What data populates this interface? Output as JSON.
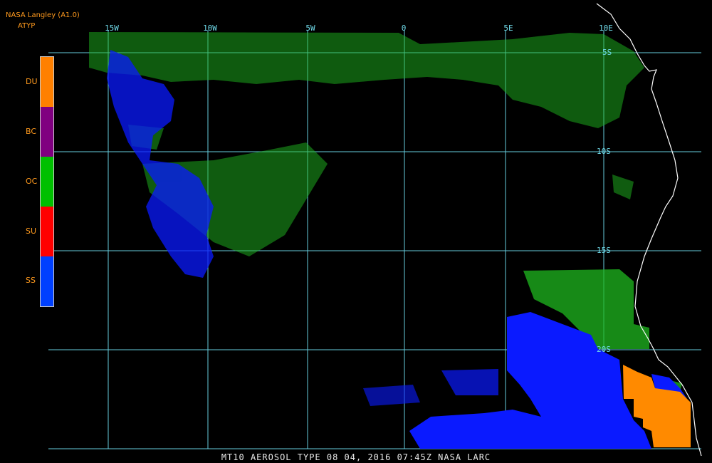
{
  "header": {
    "source": "NASA Langley (A1.0)",
    "product": "ATYP"
  },
  "legend": {
    "items": [
      {
        "label": "DU",
        "color": "#ff8000"
      },
      {
        "label": "BC",
        "color": "#800080"
      },
      {
        "label": "OC",
        "color": "#00c000"
      },
      {
        "label": "SU",
        "color": "#ff0000"
      },
      {
        "label": "SS",
        "color": "#0040ff"
      }
    ]
  },
  "grid": {
    "color": "#66ccdd",
    "lon_labels": [
      "15W",
      "10W",
      "5W",
      "0",
      "5E",
      "10E"
    ],
    "lat_labels": [
      "5S",
      "10S",
      "15S",
      "20S"
    ]
  },
  "footer": "MT10  AEROSOL TYPE   08 04, 2016 07:45Z   NASA LARC",
  "colors": {
    "background": "#000000",
    "coastline": "#ffffff",
    "oc_plume": "#1fb81f",
    "ss_cloud": "#0a1aff",
    "du": "#ff8a00"
  }
}
